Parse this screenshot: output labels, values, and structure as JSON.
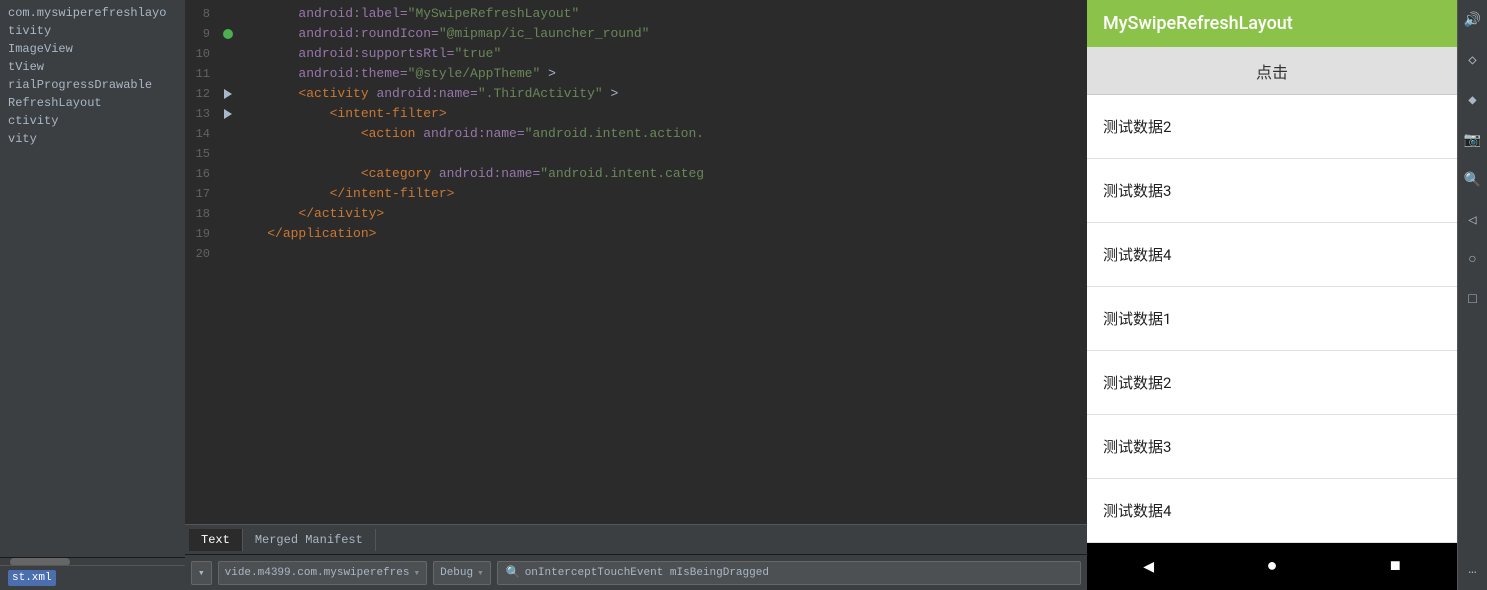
{
  "leftPanel": {
    "treeItems": [
      {
        "label": "com.myswiperefreshlayo",
        "selected": false
      },
      {
        "label": "tivity",
        "selected": false
      },
      {
        "label": "ImageView",
        "selected": false
      },
      {
        "label": "tView",
        "selected": false
      },
      {
        "label": "rialProgressDrawable",
        "selected": false
      },
      {
        "label": "RefreshLayout",
        "selected": false
      },
      {
        "label": "ctivity",
        "selected": false
      },
      {
        "label": "vity",
        "selected": false
      }
    ],
    "selectedFile": "st.xml"
  },
  "codeEditor": {
    "lines": [
      {
        "num": "8",
        "indicator": null,
        "content": "        android:label=\"MySwipeRefreshLayout\"",
        "tokens": [
          {
            "text": "        android:label=",
            "cls": "kw-attr"
          },
          {
            "text": "\"MySwipeRefreshLayout\"",
            "cls": "kw-val"
          }
        ]
      },
      {
        "num": "9",
        "indicator": "dot",
        "content": "        android:roundIcon=\"@mipmap/ic_launcher_round\"",
        "tokens": [
          {
            "text": "        android:roundIcon=",
            "cls": "kw-attr"
          },
          {
            "text": "\"@mipmap/ic_launcher_round\"",
            "cls": "kw-val"
          }
        ]
      },
      {
        "num": "10",
        "indicator": null,
        "content": "        android:supportsRtl=\"true\"",
        "tokens": [
          {
            "text": "        android:supportsRtl=",
            "cls": "kw-attr"
          },
          {
            "text": "\"true\"",
            "cls": "kw-val"
          }
        ]
      },
      {
        "num": "11",
        "indicator": null,
        "content": "        android:theme=\"@style/AppTheme\" >",
        "tokens": [
          {
            "text": "        android:theme=",
            "cls": "kw-attr"
          },
          {
            "text": "\"@style/AppTheme\"",
            "cls": "kw-val"
          },
          {
            "text": " >",
            "cls": ""
          }
        ]
      },
      {
        "num": "12",
        "indicator": "arrow",
        "content": "        <activity android:name=\".ThirdActivity\" >",
        "tokens": [
          {
            "text": "        ",
            "cls": ""
          },
          {
            "text": "<activity",
            "cls": "kw-tag"
          },
          {
            "text": " android:name=",
            "cls": "kw-attr"
          },
          {
            "text": "\".ThirdActivity\"",
            "cls": "kw-val"
          },
          {
            "text": " >",
            "cls": ""
          }
        ]
      },
      {
        "num": "13",
        "indicator": "arrow",
        "content": "            <intent-filter>",
        "tokens": [
          {
            "text": "            ",
            "cls": ""
          },
          {
            "text": "<intent-filter>",
            "cls": "kw-tag"
          }
        ]
      },
      {
        "num": "14",
        "indicator": null,
        "content": "                <action android:name=\"android.intent.action.",
        "tokens": [
          {
            "text": "                ",
            "cls": ""
          },
          {
            "text": "<action",
            "cls": "kw-tag"
          },
          {
            "text": " android:name=",
            "cls": "kw-attr"
          },
          {
            "text": "\"android.intent.action.",
            "cls": "kw-val"
          }
        ]
      },
      {
        "num": "15",
        "indicator": null,
        "content": "",
        "tokens": []
      },
      {
        "num": "16",
        "indicator": null,
        "content": "                <category android:name=\"android.intent.categ",
        "tokens": [
          {
            "text": "                ",
            "cls": ""
          },
          {
            "text": "<category",
            "cls": "kw-tag"
          },
          {
            "text": " android:name=",
            "cls": "kw-attr"
          },
          {
            "text": "\"android.intent.categ",
            "cls": "kw-val"
          }
        ]
      },
      {
        "num": "17",
        "indicator": null,
        "content": "            </intent-filter>",
        "tokens": [
          {
            "text": "            ",
            "cls": ""
          },
          {
            "text": "</intent-filter>",
            "cls": "kw-tag"
          }
        ]
      },
      {
        "num": "18",
        "indicator": null,
        "content": "        </activity>",
        "tokens": [
          {
            "text": "        ",
            "cls": ""
          },
          {
            "text": "</activity>",
            "cls": "kw-tag"
          }
        ]
      },
      {
        "num": "19",
        "indicator": null,
        "content": "    </application>",
        "tokens": [
          {
            "text": "    ",
            "cls": ""
          },
          {
            "text": "</application>",
            "cls": "kw-tag"
          }
        ]
      },
      {
        "num": "20",
        "indicator": null,
        "content": "",
        "tokens": []
      }
    ],
    "tabs": [
      {
        "label": "Text",
        "active": true
      },
      {
        "label": "Merged Manifest",
        "active": false
      }
    ]
  },
  "debugBar": {
    "dropdown1Label": "",
    "dropdown2Label": "vide.m4399.com.myswiperefres",
    "dropdown3Label": "Debug",
    "searchText": "onInterceptTouchEvent mIsBeingDragged",
    "searchIcon": "🔍"
  },
  "phonePreview": {
    "appTitle": "MySwipeRefreshLayout",
    "clickButtonLabel": "点击",
    "listItems": [
      "测试数据2",
      "测试数据3",
      "测试数据4",
      "测试数据1",
      "测试数据2",
      "测试数据3",
      "测试数据4"
    ],
    "navButtons": [
      "◀",
      "●",
      "■"
    ]
  },
  "sideToolbar": {
    "buttons": [
      {
        "icon": "🔊",
        "name": "volume-icon"
      },
      {
        "icon": "◇",
        "name": "diamond-icon"
      },
      {
        "icon": "◆",
        "name": "diamond-filled-icon"
      },
      {
        "icon": "📷",
        "name": "camera-icon"
      },
      {
        "icon": "🔍",
        "name": "zoom-icon"
      },
      {
        "icon": "◁",
        "name": "back-icon"
      },
      {
        "icon": "○",
        "name": "home-icon"
      },
      {
        "icon": "□",
        "name": "recents-icon"
      },
      {
        "icon": "…",
        "name": "more-icon"
      }
    ]
  }
}
